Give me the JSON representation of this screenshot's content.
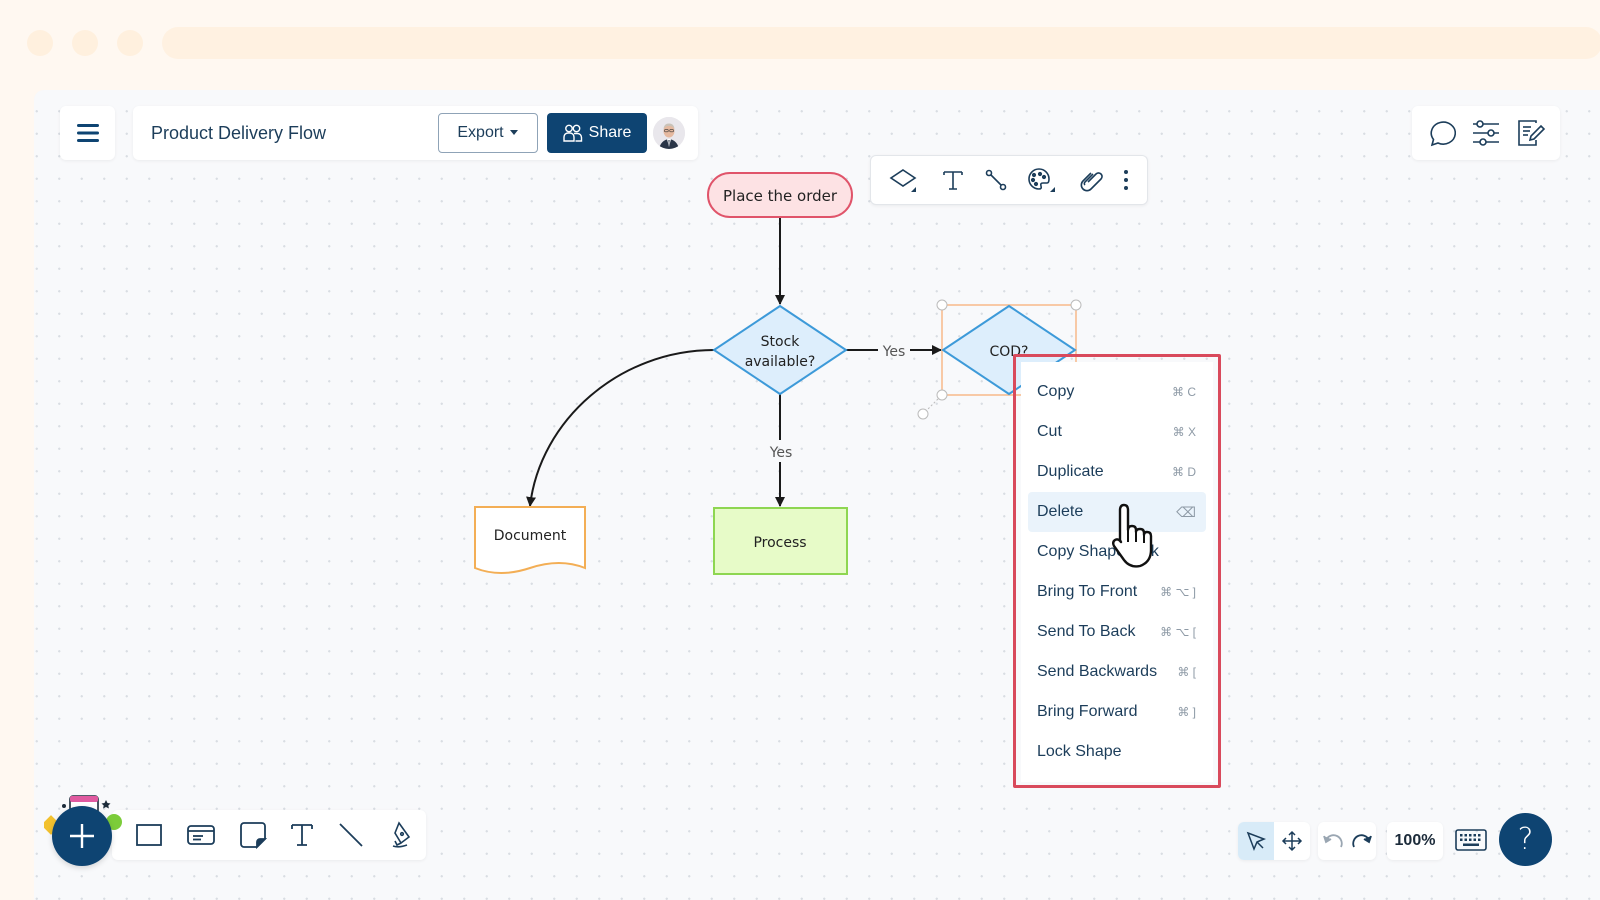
{
  "header": {
    "document_title": "Product Delivery Flow",
    "export_label": "Export",
    "share_label": "Share",
    "menu_icon": "hamburger-icon",
    "user_avatar": "user-avatar"
  },
  "right_toolbar": {
    "items": [
      {
        "name": "comments",
        "icon": "speech-bubble-icon"
      },
      {
        "name": "settings",
        "icon": "sliders-icon"
      },
      {
        "name": "notes",
        "icon": "edit-document-icon"
      }
    ]
  },
  "shape_toolbar": {
    "items": [
      {
        "name": "shape-type",
        "icon": "diamond-icon"
      },
      {
        "name": "text",
        "icon": "text-icon"
      },
      {
        "name": "connector",
        "icon": "connector-icon"
      },
      {
        "name": "color",
        "icon": "palette-icon"
      },
      {
        "name": "link",
        "icon": "link-icon"
      },
      {
        "name": "more",
        "icon": "more-vertical-icon"
      }
    ]
  },
  "diagram": {
    "nodes": [
      {
        "id": "start",
        "type": "terminator",
        "label": "Place the order",
        "fill": "#fde2e4",
        "stroke": "#e0546a"
      },
      {
        "id": "stock",
        "type": "decision",
        "label_lines": [
          "Stock",
          "available?"
        ],
        "fill": "#ddeefc",
        "stroke": "#3d9ad9"
      },
      {
        "id": "cod",
        "type": "decision",
        "label": "COD?",
        "fill": "#ddeefc",
        "stroke": "#3d9ad9",
        "selected": true
      },
      {
        "id": "document",
        "type": "document",
        "label": "Document",
        "fill": "#ffffff",
        "stroke": "#f3ae55"
      },
      {
        "id": "process",
        "type": "process",
        "label": "Process",
        "fill": "#e7fbc8",
        "stroke": "#8ed651"
      }
    ],
    "edges": [
      {
        "from": "start",
        "to": "stock",
        "label": ""
      },
      {
        "from": "stock",
        "to": "cod",
        "label": "Yes"
      },
      {
        "from": "stock",
        "to": "process",
        "label": "Yes"
      },
      {
        "from": "stock",
        "to": "document",
        "label": ""
      }
    ],
    "selection_color": "#f7b98a"
  },
  "context_menu": {
    "items": [
      {
        "label": "Copy",
        "shortcut": "⌘ C"
      },
      {
        "label": "Cut",
        "shortcut": "⌘ X"
      },
      {
        "label": "Duplicate",
        "shortcut": "⌘ D"
      },
      {
        "label": "Delete",
        "shortcut": "⌫",
        "hovered": true
      },
      {
        "label": "Copy Shape Link",
        "shortcut": ""
      },
      {
        "label": "Bring To Front",
        "shortcut": "⌘ ⌥ ]"
      },
      {
        "label": "Send To Back",
        "shortcut": "⌘ ⌥ ["
      },
      {
        "label": "Send Backwards",
        "shortcut": "⌘ ["
      },
      {
        "label": "Bring Forward",
        "shortcut": "⌘ ]"
      },
      {
        "label": "Lock Shape",
        "shortcut": ""
      }
    ],
    "highlight_color": "#d94a5c"
  },
  "bottom_toolbar": {
    "add_icon": "plus-icon",
    "tools": [
      {
        "name": "rectangle",
        "icon": "rectangle-icon"
      },
      {
        "name": "card",
        "icon": "card-icon"
      },
      {
        "name": "sticky-note",
        "icon": "sticky-note-icon"
      },
      {
        "name": "text",
        "icon": "text-icon"
      },
      {
        "name": "line",
        "icon": "line-icon"
      },
      {
        "name": "pen",
        "icon": "pen-icon"
      }
    ]
  },
  "bottom_right": {
    "zoom_level": "100%",
    "help_label": "?",
    "select_mode": "pointer"
  },
  "colors": {
    "primary": "#0e4472",
    "canvas": "#f8f9fb"
  }
}
